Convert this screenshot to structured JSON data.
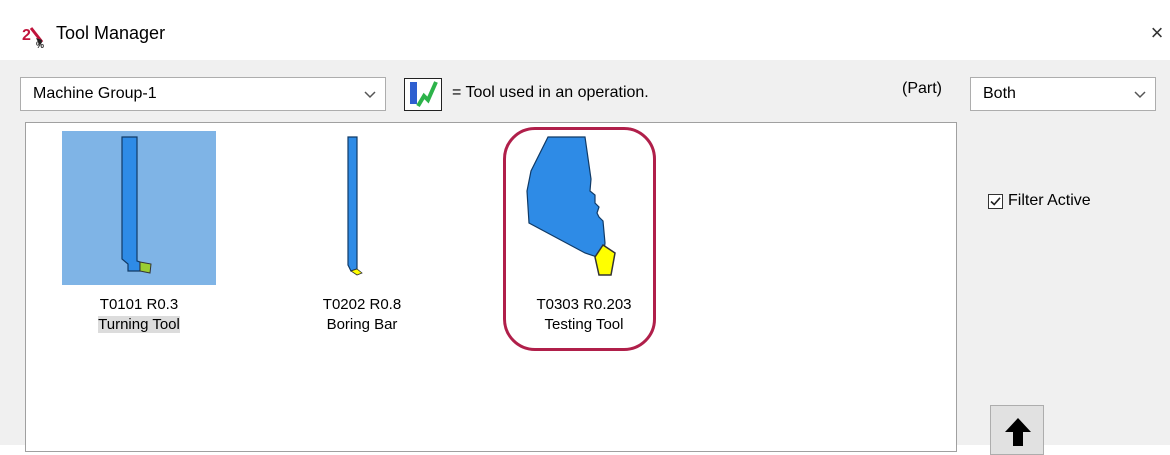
{
  "window": {
    "title": "Tool Manager",
    "close_glyph": "×",
    "app_icon": "tool-manager-icon"
  },
  "toolbar": {
    "machine_group": "Machine Group-1",
    "legend_text": "= Tool used in an operation.",
    "legend_icon": "tool-used-indicator-icon",
    "part_label": "(Part)",
    "filter_select": "Both"
  },
  "tools": [
    {
      "number": "T0101 R0.3",
      "name": "Turning Tool",
      "selected": true
    },
    {
      "number": "T0202 R0.8",
      "name": "Boring Bar",
      "selected": false
    },
    {
      "number": "T0303 R0.203",
      "name": "Testing Tool",
      "selected": false
    }
  ],
  "filter": {
    "label": "Filter Active",
    "checked": true
  },
  "colors": {
    "tool_body": "#2e8be6",
    "insert_yellow": "#ffff00",
    "insert_green": "#9acd32",
    "selection": "#7fb4e6",
    "highlight": "#b01f4a"
  }
}
